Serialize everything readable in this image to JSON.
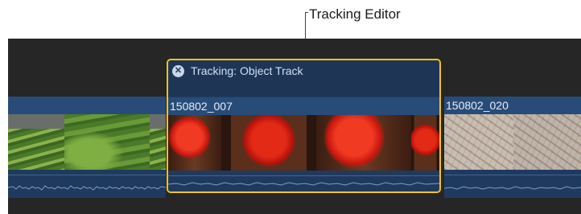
{
  "callout": {
    "label": "Tracking Editor"
  },
  "tracking_editor": {
    "title": "Tracking: Object Track",
    "close_icon": "close-circle-icon"
  },
  "clips": [
    {
      "name": ""
    },
    {
      "name": "150802_007"
    },
    {
      "name": "150802_020"
    }
  ],
  "colors": {
    "timeline_bg": "#262626",
    "clip_blue": "#1f3a5e",
    "clip_title": "#284c78",
    "selection_yellow": "#f2c518",
    "waveform": "#7f9cc4"
  }
}
